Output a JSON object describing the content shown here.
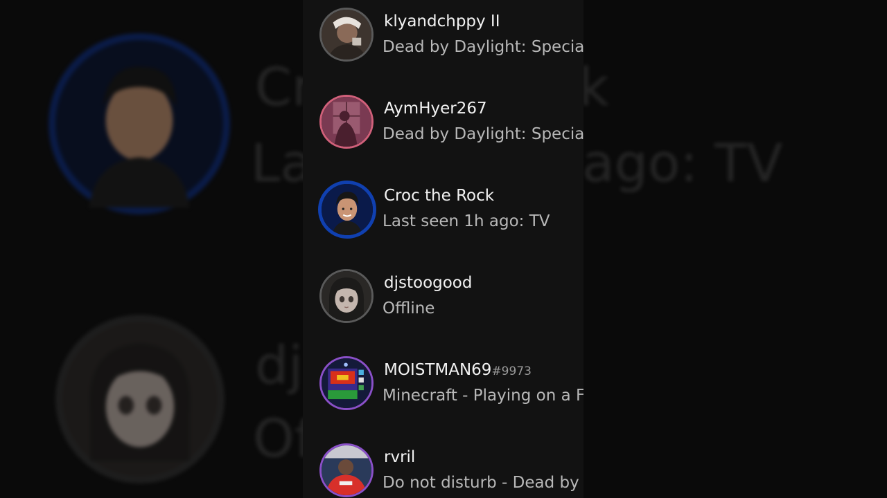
{
  "background": {
    "text_top_left": "Cr",
    "text_top_right": "k",
    "text_mid_left": "La",
    "text_mid_right": "ago: TV",
    "text_low_left": "dj",
    "text_bottom_left": "Of"
  },
  "friends": [
    {
      "name": "klyandchppy II",
      "tag": "",
      "status": "Dead by Daylight: Special",
      "ring_color": "#5a5a5a"
    },
    {
      "name": "AymHyer267",
      "tag": "",
      "status": "Dead by Daylight: Special",
      "ring_color": "#d0607a"
    },
    {
      "name": "Croc the Rock",
      "tag": "",
      "status": "Last seen 1h ago: TV",
      "ring_color": "#1040b0"
    },
    {
      "name": "djstoogood",
      "tag": "",
      "status": "Offline",
      "ring_color": "#5a5a5a"
    },
    {
      "name": "MOISTMAN69",
      "tag": "#9973",
      "status": "Minecraft - Playing on a F",
      "ring_color": "#8a50c8"
    },
    {
      "name": "rvril",
      "tag": "",
      "status": "Do not disturb - Dead by",
      "ring_color": "#8a50c8"
    }
  ]
}
